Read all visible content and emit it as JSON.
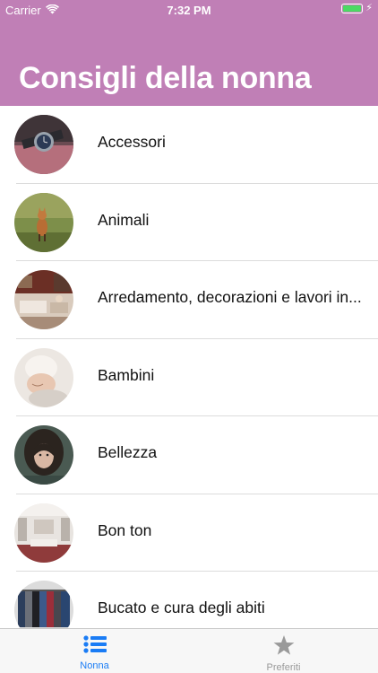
{
  "status_bar": {
    "carrier": "Carrier",
    "time": "7:32 PM"
  },
  "header": {
    "title": "Consigli della nonna",
    "background_color": "#c07fb6"
  },
  "list": {
    "items": [
      {
        "label": "Accessori",
        "thumbnail": "wristwatch-photo"
      },
      {
        "label": "Animali",
        "thumbnail": "fox-photo"
      },
      {
        "label": "Arredamento, decorazioni e lavori in...",
        "thumbnail": "living-room-photo"
      },
      {
        "label": "Bambini",
        "thumbnail": "baby-photo"
      },
      {
        "label": "Bellezza",
        "thumbnail": "woman-portrait-photo"
      },
      {
        "label": "Bon ton",
        "thumbnail": "shop-interior-photo"
      },
      {
        "label": "Bucato e cura degli abiti",
        "thumbnail": "clothes-rack-photo"
      }
    ]
  },
  "tabbar": {
    "tabs": [
      {
        "label": "Nonna",
        "icon": "list-icon",
        "active": true
      },
      {
        "label": "Preferiti",
        "icon": "star-icon",
        "active": false
      }
    ],
    "active_color": "#1a7cf5",
    "inactive_color": "#9a9a9a"
  }
}
